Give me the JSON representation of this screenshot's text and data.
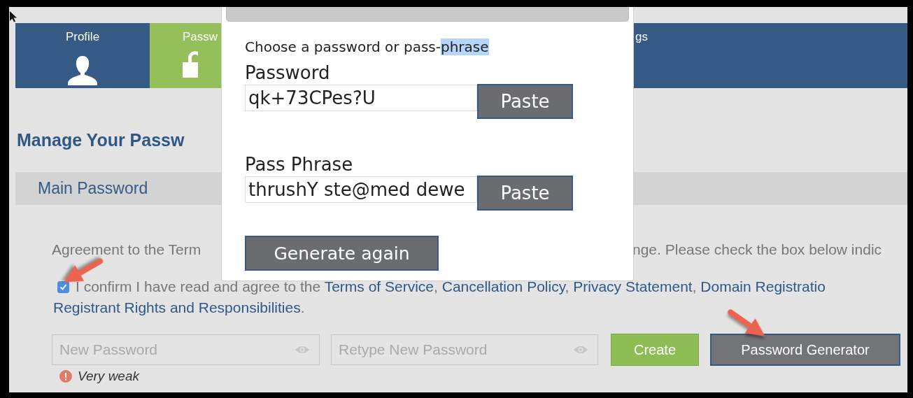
{
  "tabs": [
    {
      "label": "Profile",
      "selected": false
    },
    {
      "label": "Passw",
      "selected": true
    },
    {
      "label": "gs",
      "selected": false
    }
  ],
  "heading": "Manage Your Passw",
  "section": {
    "title": "Main Password"
  },
  "agreement": {
    "intro": "Agreement to the Term",
    "intro_rest": "nge. Please check the box below indic"
  },
  "confirm": {
    "checked": true,
    "text": "I confirm I have read and agree to the ",
    "links": [
      "Terms of Service",
      "Cancellation Policy",
      "Privacy Statement",
      "Domain Registratio",
      "Registrant Rights and Responsibilities"
    ],
    "separator": ", ",
    "end": "."
  },
  "form": {
    "fields": [
      {
        "placeholder": "New Password"
      },
      {
        "placeholder": "Retype New Password"
      }
    ],
    "buttons": [
      {
        "label": "Create",
        "kind": "primary"
      },
      {
        "label": "Password Generator",
        "kind": "secondary"
      }
    ],
    "strength": "Very weak"
  },
  "popup": {
    "prompt": "Choose a password or pass-",
    "prompt_selected": "phrase",
    "fields": [
      {
        "label": "Password",
        "value": "qk+73CPes?U",
        "button": "Paste"
      },
      {
        "label": "Pass Phrase",
        "value": "thrushY ste@med dewe",
        "button": "Paste"
      }
    ],
    "generate_button": "Generate again"
  }
}
